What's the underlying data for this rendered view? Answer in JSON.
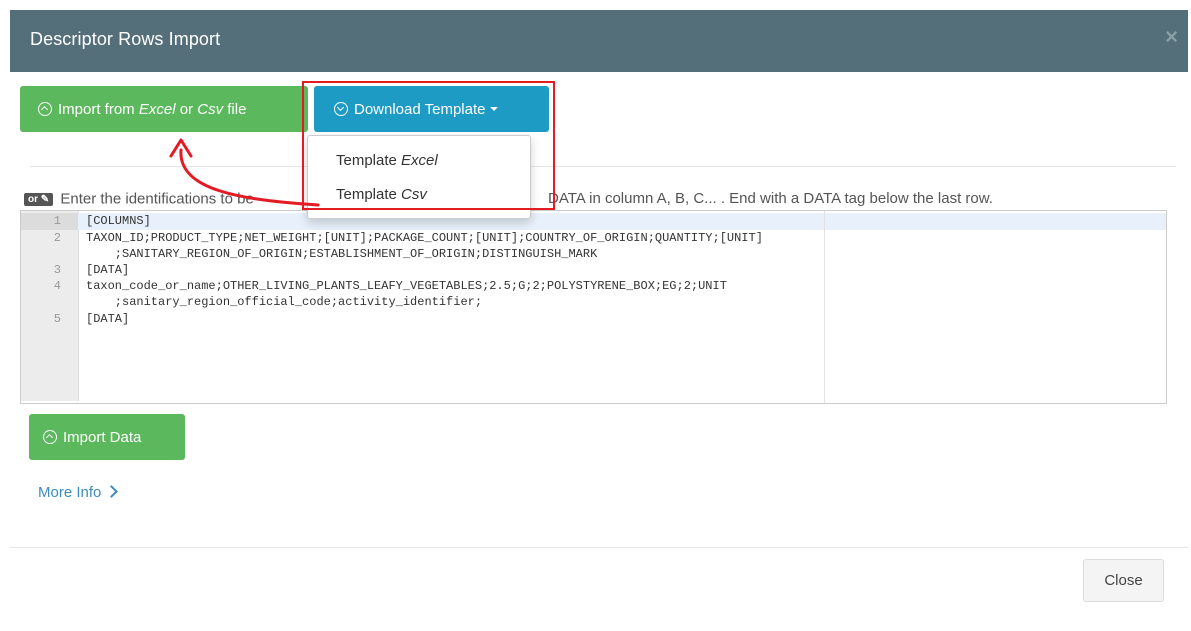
{
  "modal": {
    "title": "Descriptor Rows Import",
    "close_icon": "times-icon"
  },
  "toolbar": {
    "import_file_prefix": "Import from ",
    "import_file_excel": "Excel",
    "import_file_or": " or ",
    "import_file_csv": "Csv",
    "import_file_suffix": " file",
    "download_template_label": "Download Template"
  },
  "dropdown": {
    "items": [
      {
        "prefix": "Template ",
        "format": "Excel"
      },
      {
        "prefix": "Template ",
        "format": "Csv"
      }
    ]
  },
  "hint": {
    "badge": "or",
    "badge_icon": "pencil-icon",
    "text_left": "Enter the identifications to be",
    "text_right": "DATA in column A, B, C... . End with a DATA tag below the last row."
  },
  "editor": {
    "lines": [
      {
        "num": "1",
        "text": "[COLUMNS]"
      },
      {
        "num": "2",
        "text": "TAXON_ID;PRODUCT_TYPE;NET_WEIGHT;[UNIT];PACKAGE_COUNT;[UNIT];COUNTRY_OF_ORIGIN;QUANTITY;[UNIT]",
        "wrap": "    ;SANITARY_REGION_OF_ORIGIN;ESTABLISHMENT_OF_ORIGIN;DISTINGUISH_MARK"
      },
      {
        "num": "3",
        "text": "[DATA]"
      },
      {
        "num": "4",
        "text": "taxon_code_or_name;OTHER_LIVING_PLANTS_LEAFY_VEGETABLES;2.5;G;2;POLYSTYRENE_BOX;EG;2;UNIT",
        "wrap": "    ;sanitary_region_official_code;activity_identifier;"
      },
      {
        "num": "5",
        "text": "[DATA]"
      }
    ]
  },
  "actions": {
    "import_data_label": "Import Data",
    "more_info_label": "More Info",
    "close_label": "Close"
  },
  "colors": {
    "header": "#546e7a",
    "green": "#5cb85c",
    "blue": "#1e9bc4",
    "highlight": "#e31b23",
    "link": "#3c8dbc"
  }
}
